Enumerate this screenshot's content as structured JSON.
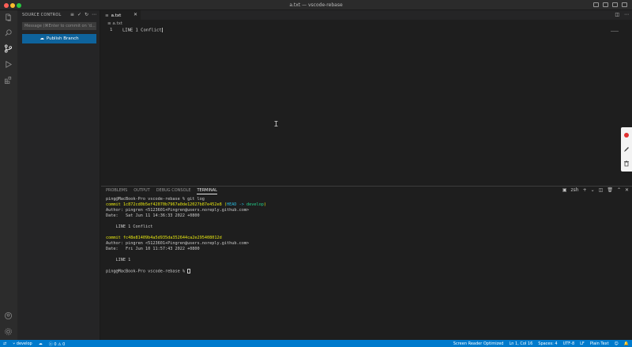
{
  "window": {
    "title": "a.txt — vscode-rebase"
  },
  "sidebar": {
    "title": "SOURCE CONTROL",
    "message_placeholder": "Message (⌘Enter to commit on 'd...",
    "publish_label": "Publish Branch"
  },
  "editor": {
    "tab_label": "a.txt",
    "breadcrumb": "a.txt",
    "lines": [
      {
        "num": "1",
        "text": "LINE 1 Conflict"
      }
    ]
  },
  "panel": {
    "tabs": [
      "PROBLEMS",
      "OUTPUT",
      "DEBUG CONSOLE",
      "TERMINAL"
    ],
    "active_tab": "TERMINAL",
    "shell": "zsh",
    "terminal": {
      "prompt1": "ping@MacBook-Pro vscode-rebase % git log",
      "commit1_prefix": "commit 1c872cd0b5ef42070b7967a0de12027b87e452e8 (",
      "commit1_head": "HEAD -> ",
      "commit1_branch": "develop",
      "commit1_suffix": ")",
      "author1": "Author: pingren <5123601+Pingren@users.noreply.github.com>",
      "date1": "Date:   Sat Jun 11 14:36:33 2022 +0800",
      "msg1": "    LINE 1 Conflict",
      "commit2": "commit fc48e81409b4a5d935da352644ca2e295408012d",
      "author2": "Author: pingren <5123601+Pingren@users.noreply.github.com>",
      "date2": "Date:   Fri Jun 10 11:57:43 2022 +0800",
      "msg2": "    LINE 1",
      "prompt2": "ping@MacBook-Pro vscode-rebase % "
    }
  },
  "statusbar": {
    "branch": "develop",
    "sync": "",
    "errors": "0",
    "warnings": "0",
    "screen_reader": "Screen Reader Optimized",
    "position": "Ln 1, Col 16",
    "spaces": "Spaces: 4",
    "encoding": "UTF-8",
    "eol": "LF",
    "language": "Plain Text"
  },
  "colors": {
    "accent": "#007acc",
    "button": "#0e639c",
    "terminal_yellow": "#e5e510",
    "terminal_cyan": "#29b8db",
    "terminal_green": "#23d18b"
  }
}
